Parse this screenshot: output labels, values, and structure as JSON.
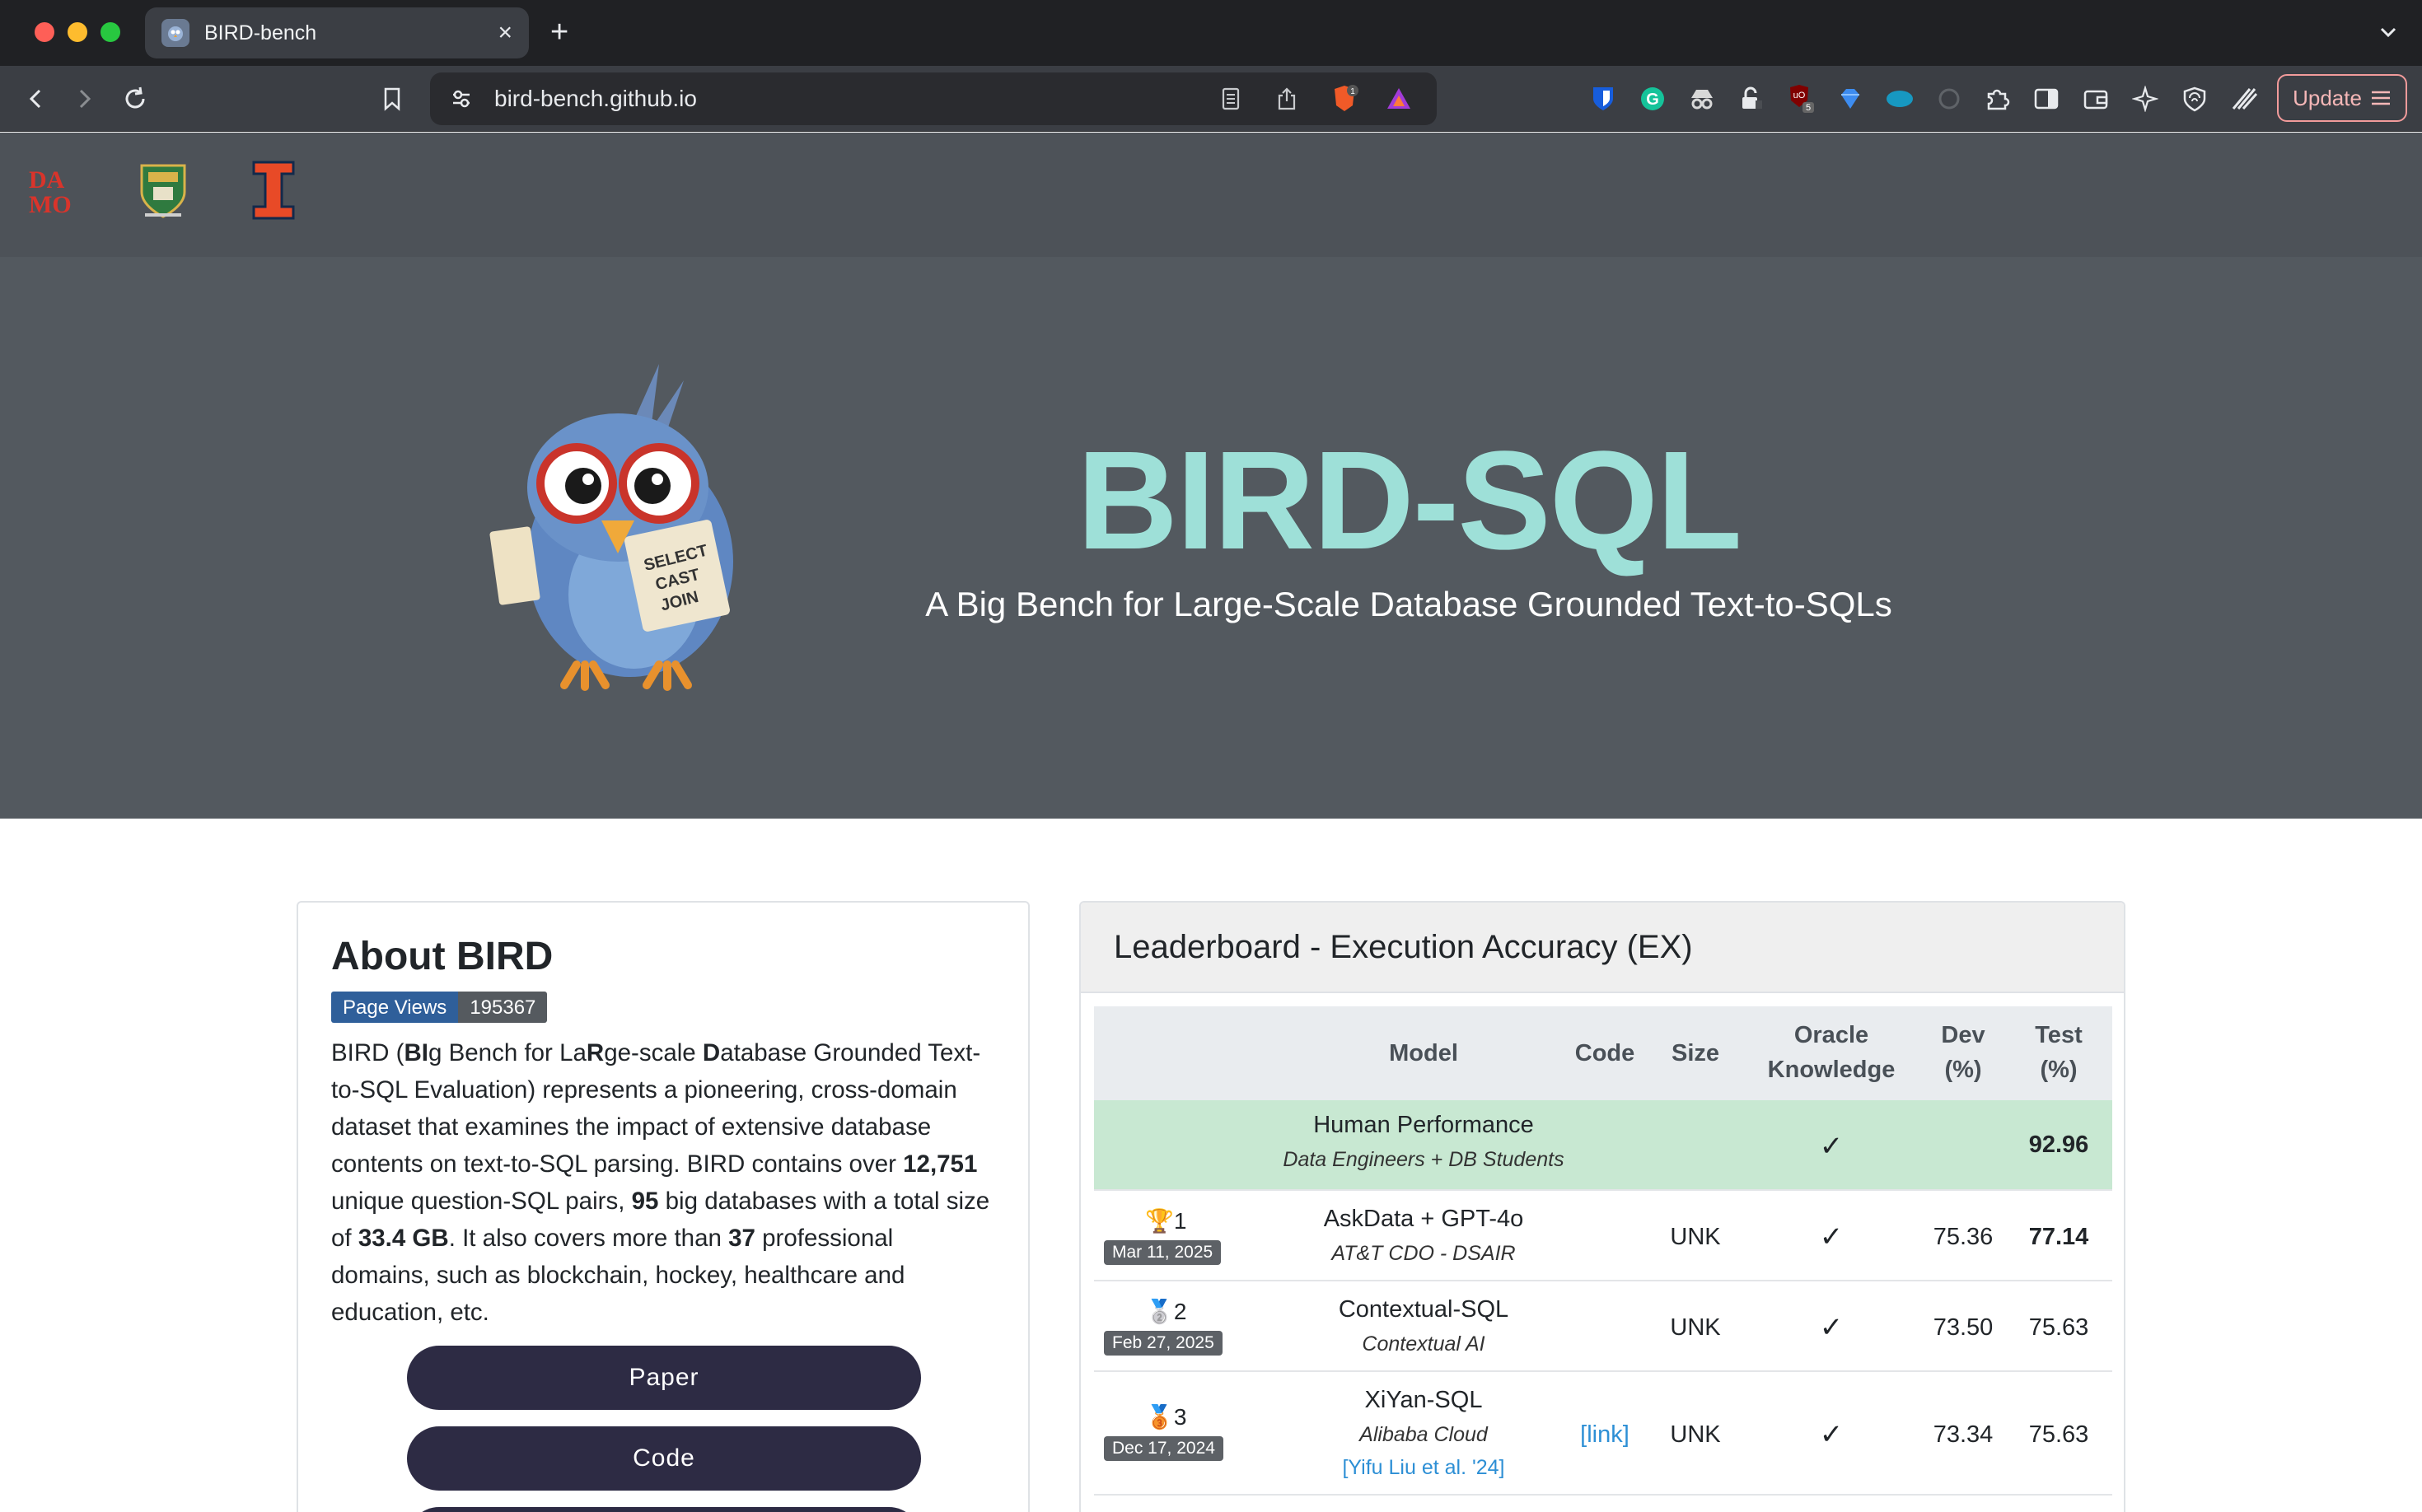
{
  "browser": {
    "tab_title": "BIRD-bench",
    "url": "bird-bench.github.io",
    "update_label": "Update",
    "shields_count": "1",
    "ext_badge_count": "5"
  },
  "hero": {
    "title": "BIRD-SQL",
    "subtitle": "A Big Bench for Large-Scale Database Grounded Text-to-SQLs",
    "mascot_signs": [
      "SELECT",
      "CAST",
      "JOIN"
    ]
  },
  "about": {
    "title": "About BIRD",
    "page_views_label": "Page Views",
    "page_views_count": "195367",
    "paragraph": {
      "p1": "BIRD (",
      "b1": "BI",
      "p2": "g Bench for La",
      "b2": "R",
      "p3": "ge-scale ",
      "b3": "D",
      "p4": "atabase Grounded Text-to-SQL Evaluation) represents a pioneering, cross-domain dataset that examines the impact of extensive database contents on text-to-SQL parsing. BIRD contains over ",
      "b4": "12,751",
      "p5": " unique question-SQL pairs, ",
      "b5": "95",
      "p6": " big databases with a total size of ",
      "b6": "33.4 GB",
      "p7": ". It also covers more than ",
      "b7": "37",
      "p8": " professional domains, such as blockchain, hockey, healthcare and education, etc."
    },
    "buttons": {
      "paper": "Paper",
      "code": "Code"
    }
  },
  "leaderboard": {
    "title": "Leaderboard - Execution Accuracy (EX)",
    "columns": {
      "model": "Model",
      "code": "Code",
      "size": "Size",
      "oracle_1": "Oracle",
      "oracle_2": "Knowledge",
      "dev_1": "Dev",
      "dev_2": "(%)",
      "test_1": "Test",
      "test_2": "(%)"
    },
    "human": {
      "name": "Human Performance",
      "org": "Data Engineers + DB Students",
      "oracle": "✓",
      "test": "92.96"
    },
    "rows": [
      {
        "rank_icon": "🏆",
        "rank": "1",
        "date": "Mar 11, 2025",
        "model": "AskData + GPT-4o",
        "org": "AT&T CDO - DSAIR",
        "code": "",
        "ref": "",
        "size": "UNK",
        "oracle": "✓",
        "dev": "75.36",
        "test": "77.14"
      },
      {
        "rank_icon": "🥈",
        "rank": "2",
        "date": "Feb 27, 2025",
        "model": "Contextual-SQL",
        "org": "Contextual AI",
        "code": "",
        "ref": "",
        "size": "UNK",
        "oracle": "✓",
        "dev": "73.50",
        "test": "75.63"
      },
      {
        "rank_icon": "🥉",
        "rank": "3",
        "date": "Dec 17, 2024",
        "model": "XiYan-SQL",
        "org": "Alibaba Cloud",
        "code": "[link]",
        "ref": "[Yifu Liu et al. '24]",
        "size": "UNK",
        "oracle": "✓",
        "dev": "73.34",
        "test": "75.63"
      }
    ]
  },
  "colors": {
    "title_accent": "#9ee0d8",
    "hero_bg": "#53595f",
    "button_bg": "#2d2b44",
    "human_row": "#c8e8d2"
  }
}
